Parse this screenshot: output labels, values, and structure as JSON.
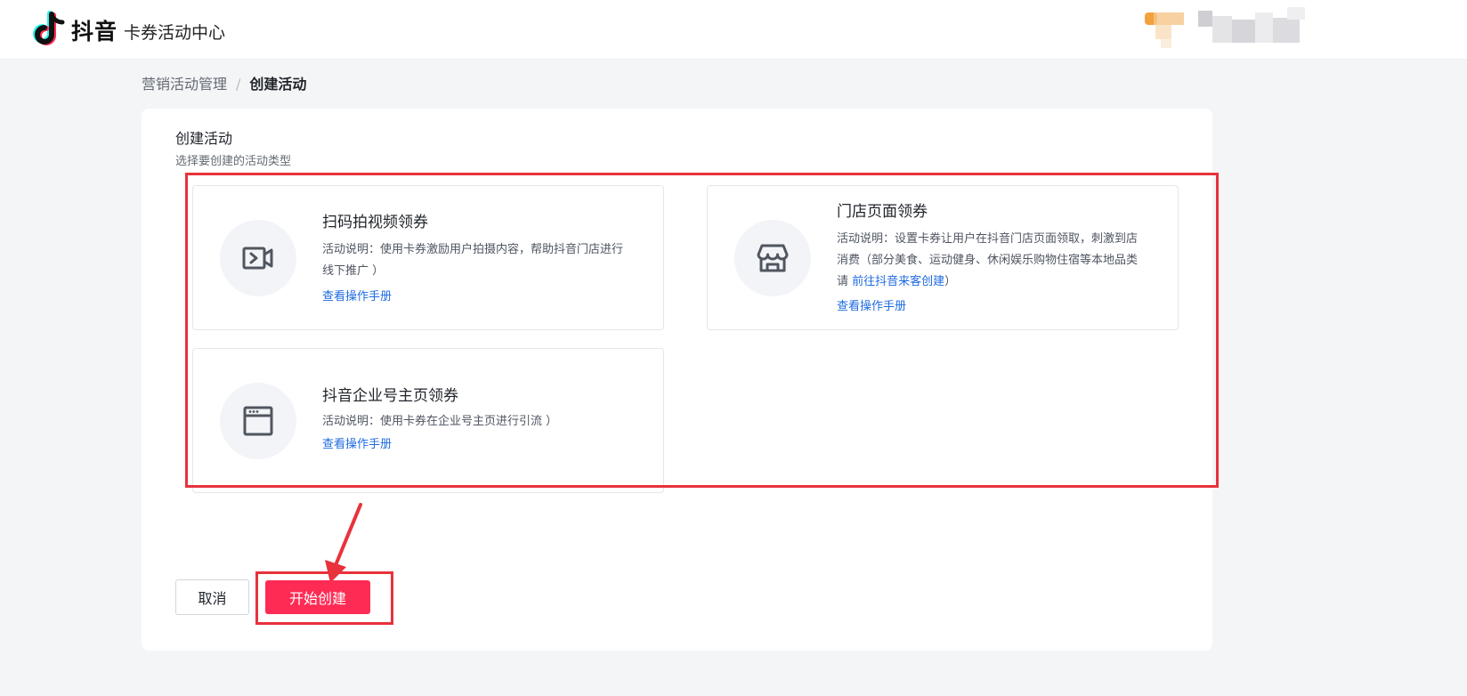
{
  "header": {
    "brand": "抖音",
    "app_title": "卡券活动中心"
  },
  "breadcrumb": {
    "parent": "营销活动管理",
    "separator": "/",
    "current": "创建活动"
  },
  "panel": {
    "title": "创建活动",
    "subtitle": "选择要创建的活动类型"
  },
  "cards": [
    {
      "icon": "video-icon",
      "name": "扫码拍视频领券",
      "desc": "活动说明：使用卡券激励用户拍摄内容，帮助抖音门店进行线下推广 ）",
      "link": "查看操作手册"
    },
    {
      "icon": "store-icon",
      "name": "门店页面领券",
      "desc_prefix": "活动说明：设置卡券让用户在抖音门店页面领取，刺激到店消费（部分美食、运动健身、休闲娱乐购物住宿等本地品类请 ",
      "desc_link": "前往抖音来客创建",
      "desc_suffix": "）",
      "link": "查看操作手册"
    },
    {
      "icon": "browser-window-icon",
      "name": "抖音企业号主页领券",
      "desc": "活动说明：使用卡券在企业号主页进行引流 ）",
      "link": "查看操作手册"
    }
  ],
  "actions": {
    "cancel": "取消",
    "create": "开始创建"
  },
  "colors": {
    "primary": "#fe2c55",
    "link": "#1f6be0",
    "annotation": "#e8323c"
  }
}
